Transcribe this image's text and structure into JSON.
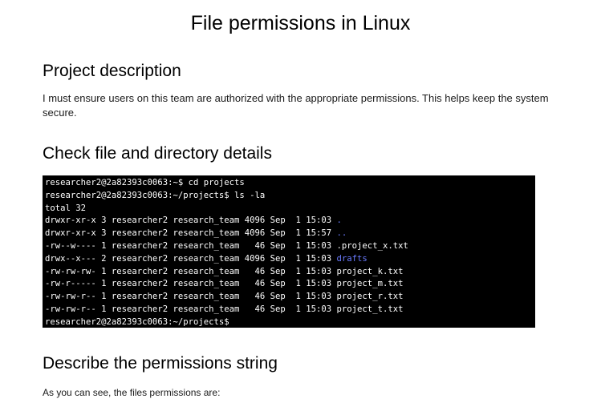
{
  "document": {
    "title": "File permissions in Linux",
    "sections": [
      {
        "heading": "Project description",
        "body": "I must ensure users on this team are authorized with the appropriate permissions. This helps keep the system secure."
      },
      {
        "heading": "Check file and directory details"
      },
      {
        "heading": "Describe the permissions string",
        "body": "As you can see, the files permissions are:"
      }
    ]
  },
  "terminal": {
    "background": "#000000",
    "text_color": "#ffffff",
    "directory_color": "#6a7bff",
    "lines": [
      {
        "text": "researcher2@2a82393c0063:~$ cd projects",
        "dir": ""
      },
      {
        "text": "researcher2@2a82393c0063:~/projects$ ls -la",
        "dir": ""
      },
      {
        "text": "total 32",
        "dir": ""
      },
      {
        "text": "drwxr-xr-x 3 researcher2 research_team 4096 Sep  1 15:03 ",
        "dir": "."
      },
      {
        "text": "drwxr-xr-x 3 researcher2 research_team 4096 Sep  1 15:57 ",
        "dir": ".."
      },
      {
        "text": "-rw--w---- 1 researcher2 research_team   46 Sep  1 15:03 .project_x.txt",
        "dir": ""
      },
      {
        "text": "drwx--x--- 2 researcher2 research_team 4096 Sep  1 15:03 ",
        "dir": "drafts"
      },
      {
        "text": "-rw-rw-rw- 1 researcher2 research_team   46 Sep  1 15:03 project_k.txt",
        "dir": ""
      },
      {
        "text": "-rw-r----- 1 researcher2 research_team   46 Sep  1 15:03 project_m.txt",
        "dir": ""
      },
      {
        "text": "-rw-rw-r-- 1 researcher2 research_team   46 Sep  1 15:03 project_r.txt",
        "dir": ""
      },
      {
        "text": "-rw-rw-r-- 1 researcher2 research_team   46 Sep  1 15:03 project_t.txt",
        "dir": ""
      },
      {
        "text": "researcher2@2a82393c0063:~/projects$",
        "dir": ""
      }
    ]
  }
}
